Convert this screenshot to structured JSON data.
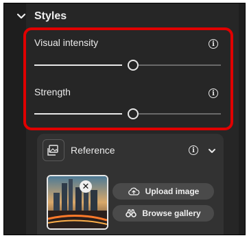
{
  "styles": {
    "title": "Styles",
    "sliders": [
      {
        "label": "Visual intensity",
        "value": 0.43
      },
      {
        "label": "Strength",
        "value": 0.43
      }
    ]
  },
  "reference": {
    "title": "Reference",
    "upload_label": "Upload image",
    "browse_label": "Browse gallery"
  },
  "colors": {
    "panel": "#262626",
    "card": "#323232",
    "highlight": "#e00000",
    "accent_text": "#f0f0f0"
  }
}
